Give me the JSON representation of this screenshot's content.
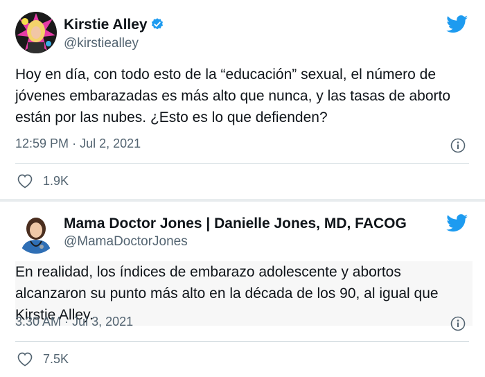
{
  "tweets": [
    {
      "name": "Kirstie Alley",
      "handle": "@kirstiealley",
      "text": "Hoy en día, con todo esto de la “educación” sexual, el número de jóvenes embarazadas es más alto que nunca, y las tasas de aborto están por las nubes. ¿Esto es lo que defienden?",
      "time": "12:59 PM",
      "date": "Jul 2, 2021",
      "likes": "1.9K",
      "verified": true
    },
    {
      "name": "Mama Doctor Jones | Danielle Jones, MD, FACOG",
      "handle": "@MamaDoctorJones",
      "text": "En realidad, los índices de embarazo adolescente y abortos alcanzaron su punto más alto en la década de los 90, al igual que Kirstie Alley.",
      "time": "3:30 AM",
      "date": "Jul 3, 2021",
      "likes": "7.5K",
      "verified": false
    }
  ],
  "separator": "·",
  "colors": {
    "twitter_blue": "#1d9bf0",
    "secondary_text": "#536471",
    "divider": "#e8ecee"
  },
  "icons": [
    "twitter-bird-icon",
    "verified-badge-icon",
    "info-icon",
    "heart-icon"
  ]
}
